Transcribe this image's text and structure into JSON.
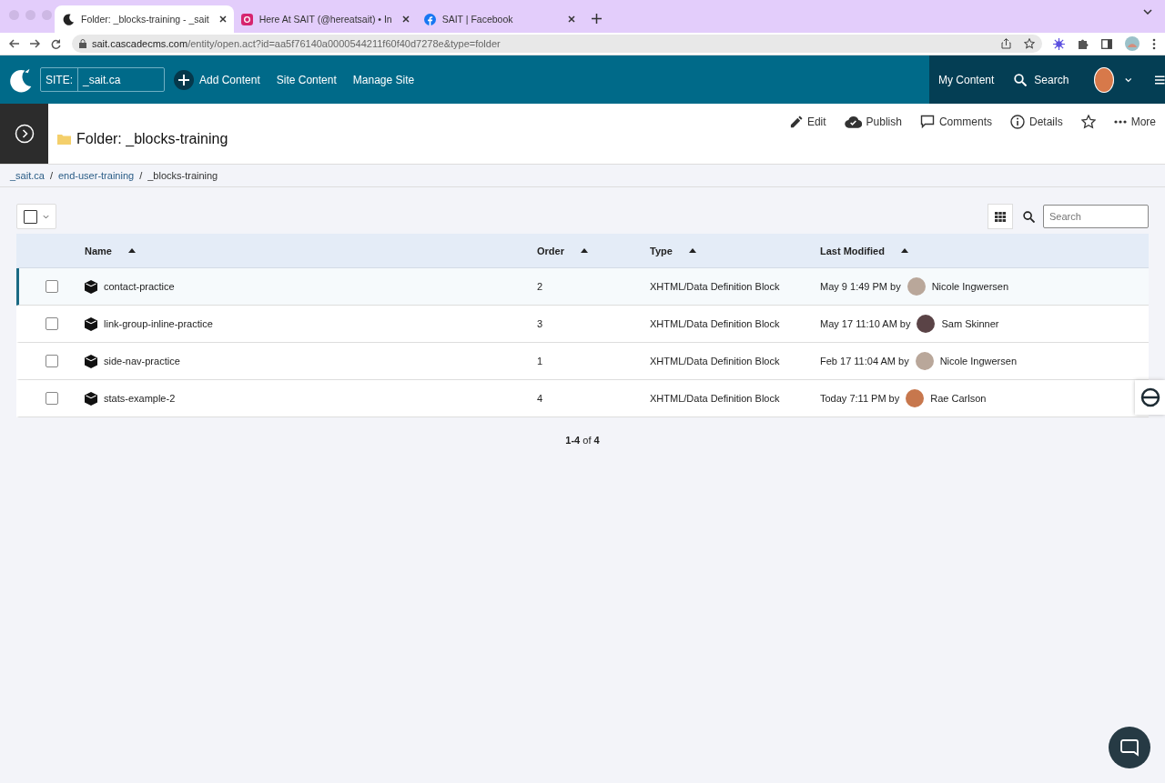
{
  "browser": {
    "tabs": [
      {
        "title": "Folder: _blocks-training - _sait",
        "kind": "cascade",
        "selected": true
      },
      {
        "title": "Here At SAIT (@hereatsait) • In",
        "kind": "instagram",
        "selected": false
      },
      {
        "title": "SAIT | Facebook",
        "kind": "facebook",
        "selected": false
      }
    ],
    "url": {
      "host": "sait.cascadecms.com",
      "path": "/entity/open.act?id=aa5f76140a0000544211f60f40d7278e&type=folder"
    }
  },
  "header": {
    "site_label": "SITE:",
    "site_value": "_sait.ca",
    "nav": [
      "Add Content",
      "Site Content",
      "Manage Site"
    ],
    "my_content": "My Content",
    "search": "Search"
  },
  "page": {
    "title": "Folder: _blocks-training",
    "actions": [
      {
        "kind": "edit",
        "label": "Edit"
      },
      {
        "kind": "publish",
        "label": "Publish"
      },
      {
        "kind": "comments",
        "label": "Comments"
      },
      {
        "kind": "details",
        "label": "Details"
      },
      {
        "kind": "star"
      },
      {
        "kind": "more",
        "label": "More"
      }
    ],
    "breadcrumb_separator": "/",
    "breadcrumb": [
      "_sait.ca",
      "end-user-training",
      "_blocks-training"
    ]
  },
  "toolbar": {
    "search_placeholder": "Search"
  },
  "table": {
    "columns": [
      "Name",
      "Order",
      "Type",
      "Last Modified"
    ],
    "rows": [
      {
        "name": "contact-practice",
        "order": "2",
        "type": "XHTML/Data Definition Block",
        "modified": "May 9 1:49 PM by",
        "user": "Nicole Ingwersen",
        "checked": false,
        "selected": true
      },
      {
        "name": "link-group-inline-practice",
        "order": "3",
        "type": "XHTML/Data Definition Block",
        "modified": "May 17 11:10 AM by",
        "user": "Sam Skinner",
        "checked": false,
        "selected": false
      },
      {
        "name": "side-nav-practice",
        "order": "1",
        "type": "XHTML/Data Definition Block",
        "modified": "Feb 17 11:04 AM by",
        "user": "Nicole Ingwersen",
        "checked": false,
        "selected": false
      },
      {
        "name": "stats-example-2",
        "order": "4",
        "type": "XHTML/Data Definition Block",
        "modified": "Today 7:11 PM by",
        "user": "Rae Carlson",
        "checked": false,
        "selected": false
      }
    ]
  },
  "pagination": "**1-4** of **4**"
}
